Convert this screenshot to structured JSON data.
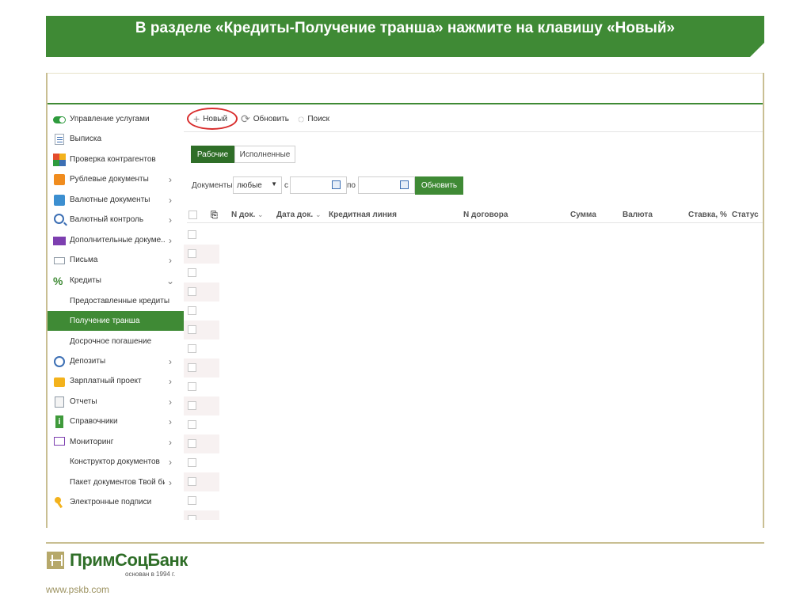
{
  "title": "В разделе «Кредиты-Получение транша» нажмите на клавишу «Новый»",
  "sidebar": {
    "items": [
      {
        "label": "Управление услугами",
        "icon": "toggle-icon",
        "chevron": ""
      },
      {
        "label": "Выписка",
        "icon": "statement-icon",
        "chevron": ""
      },
      {
        "label": "Проверка контрагентов",
        "icon": "counterparty-check-icon",
        "chevron": ""
      },
      {
        "label": "Рублевые документы",
        "icon": "ruble-document-icon",
        "chevron": "›"
      },
      {
        "label": "Валютные документы",
        "icon": "currency-document-icon",
        "chevron": "›"
      },
      {
        "label": "Валютный контроль",
        "icon": "currency-control-icon",
        "chevron": "›"
      },
      {
        "label": "Дополнительные докуме...",
        "icon": "folder-icon",
        "chevron": "›"
      },
      {
        "label": "Письма",
        "icon": "letter-icon",
        "chevron": "›"
      },
      {
        "label": "Кредиты",
        "icon": "percent-icon",
        "chevron": "⌄"
      },
      {
        "label": "Предоставленные кредиты",
        "icon": "",
        "chevron": ""
      },
      {
        "label": "Получение транша",
        "icon": "",
        "chevron": ""
      },
      {
        "label": "Досрочное погашение",
        "icon": "",
        "chevron": ""
      },
      {
        "label": "Депозиты",
        "icon": "clock-icon",
        "chevron": "›"
      },
      {
        "label": "Зарплатный проект",
        "icon": "wallet-icon",
        "chevron": "›"
      },
      {
        "label": "Отчеты",
        "icon": "report-icon",
        "chevron": "›"
      },
      {
        "label": "Справочники",
        "icon": "info-icon",
        "chevron": "›"
      },
      {
        "label": "Мониторинг",
        "icon": "monitor-icon",
        "chevron": "›"
      },
      {
        "label": "Конструктор документов",
        "icon": "",
        "chevron": "›"
      },
      {
        "label": "Пакет документов Твой би...",
        "icon": "",
        "chevron": "›"
      },
      {
        "label": "Электронные подписи",
        "icon": "key-icon",
        "chevron": ""
      }
    ],
    "active_index": 10
  },
  "toolbar": {
    "new_label": "Новый",
    "new_icon": "+",
    "refresh_label": "Обновить",
    "search_label": "Поиск"
  },
  "tabs": [
    "Рабочие",
    "Исполненные"
  ],
  "filter": {
    "documents_label": "Документы",
    "type_value": "любые",
    "from_label": "с",
    "from_value": "",
    "to_label": "по",
    "to_value": "",
    "refresh_button": "Обновить"
  },
  "table": {
    "columns": [
      "N док.",
      "Дата док.",
      "Кредитная линия",
      "N договора",
      "Сумма",
      "Валюта",
      "Ставка, %",
      "Статус"
    ],
    "empty_rows": 16
  },
  "footer": {
    "bank_name": "ПримСоцБанк",
    "founded": "основан в 1994 г.",
    "site": "www.pskb.com"
  },
  "colors": {
    "brand_green": "#3f8a35",
    "highlight_red": "#d82c2c",
    "frame_gold": "#c9bf93"
  }
}
